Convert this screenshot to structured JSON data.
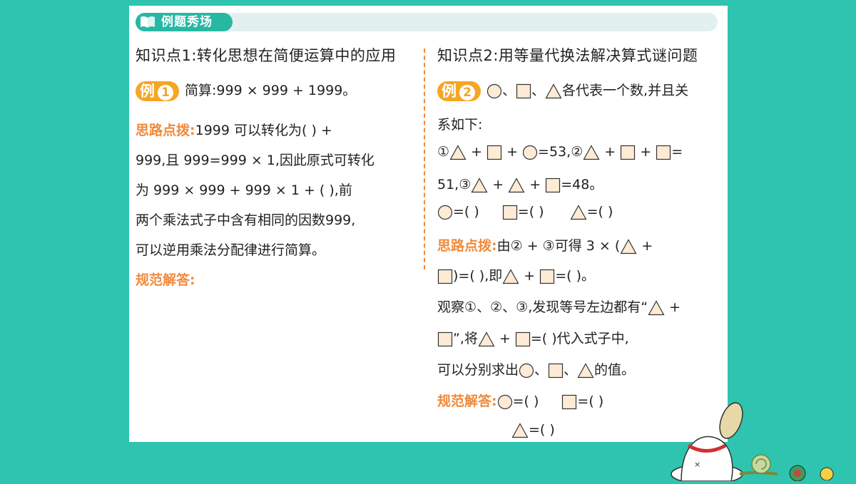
{
  "banner": {
    "label": "例题秀场"
  },
  "left": {
    "title": "知识点1:转化思想在简便运算中的应用",
    "example_badge": "例",
    "example_num": "1",
    "problem": "简算:999 × 999 + 1999。",
    "hint_label": "思路点拨:",
    "hint_line1": "1999 可以转化为(          ) +",
    "hint_line2": "999,且 999=999 × 1,因此原式可转化",
    "hint_line3": "为 999 × 999 + 999 × 1 + (        ),前",
    "hint_line4": "两个乘法式子中含有相同的因数999,",
    "hint_line5": "可以逆用乘法分配律进行简算。",
    "answer_label": "规范解答:"
  },
  "right": {
    "title": "知识点2:用等量代换法解决算式谜问题",
    "example_badge": "例",
    "example_num": "2",
    "p1_sep1": "、",
    "p1_sep2": "、",
    "p1_text": "各代表一个数,并且关",
    "p2": "系如下:",
    "eq1_a": " + ",
    "eq1_b": " + ",
    "eq1_c": "=53,",
    "eq2_a": " + ",
    "eq2_b": " + ",
    "eq2_c": "=",
    "eq3_pre": "51,",
    "eq3_a": " + ",
    "eq3_b": " + ",
    "eq3_c": "=48。",
    "blank1": "=(        )",
    "blank2": "=(        )",
    "blank3": "=(        )",
    "hint_label": "思路点拨:",
    "hint1_a": "由",
    "hint1_b": " + ",
    "hint1_c": "可得 3 × (",
    "hint1_d": " +",
    "hint2_a": ")=(          ),即",
    "hint2_b": " + ",
    "hint2_c": "=(          )。",
    "hint3_a": "观察",
    "hint3_b": "、",
    "hint3_c": "、",
    "hint3_d": ",发现等号左边都有“",
    "hint3_e": " +",
    "hint4_a": "”,将",
    "hint4_b": " + ",
    "hint4_c": "=(          )代入式子中,",
    "hint5_a": "可以分别求出",
    "hint5_b": "、",
    "hint5_c": "、",
    "hint5_d": "的值。",
    "answer_label": "规范解答:",
    "ans1": "=(          )",
    "ans2": "=(          )",
    "ans3": "=(          )",
    "circ1": "①",
    "circ2": "②",
    "circ3": "③"
  },
  "colors": {
    "background": "#2ec4b0",
    "accent": "#f08a3c",
    "badge": "#27b8a4",
    "square_fill": "#fdebd6"
  }
}
